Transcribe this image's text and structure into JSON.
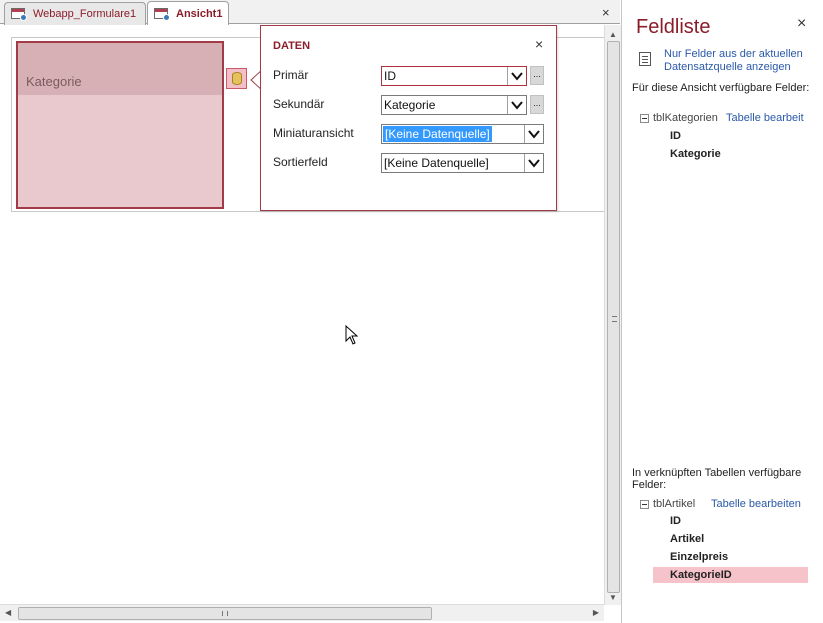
{
  "tabs": [
    {
      "label": "Webapp_Formulare1",
      "active": false
    },
    {
      "label": "Ansicht1",
      "active": true
    }
  ],
  "tab_close": "×",
  "tile": {
    "label": "Kategorie"
  },
  "popup": {
    "title": "DATEN",
    "close": "×",
    "rows": [
      {
        "label": "Primär",
        "value": "ID"
      },
      {
        "label": "Sekundär",
        "value": "Kategorie"
      },
      {
        "label": "Miniaturansicht",
        "value": "[Keine Datenquelle]"
      },
      {
        "label": "Sortierfeld",
        "value": "[Keine Datenquelle]"
      }
    ],
    "dots": "..."
  },
  "field_list": {
    "title": "Feldliste",
    "close": "×",
    "filter_link": "Nur Felder aus der aktuellen Datensatzquelle anzeigen",
    "section1": {
      "heading": "Für diese Ansicht verfügbare Felder:",
      "table": "tblKategorien",
      "edit_link": "Tabelle bearbeit",
      "fields": [
        "ID",
        "Kategorie"
      ]
    },
    "section2": {
      "heading": "In verknüpften Tabellen verfügbare Felder:",
      "table": "tblArtikel",
      "edit_link": "Tabelle bearbeiten",
      "fields": [
        "ID",
        "Artikel",
        "Einzelpreis",
        "KategorieID"
      ]
    }
  },
  "colors": {
    "accent": "#8b1c2a",
    "link": "#2a5aa8",
    "selection": "#3399ff",
    "highlight_row": "#f5c3c9"
  }
}
